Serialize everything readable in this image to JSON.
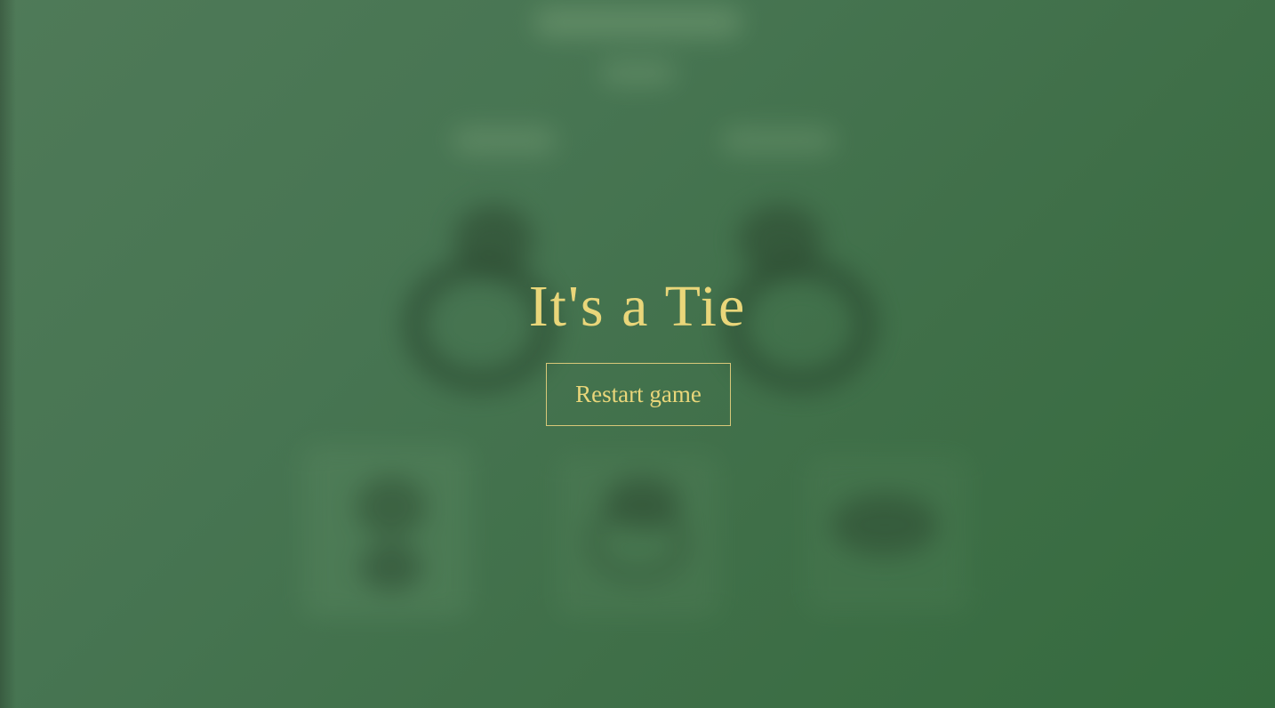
{
  "result": {
    "title": "It's a Tie"
  },
  "actions": {
    "restart_label": "Restart game"
  },
  "colors": {
    "background": "#447250",
    "accent_gold": "#e9d67a",
    "button_border": "#d8c879"
  },
  "icons": {
    "background_board": "blurred-game-board"
  }
}
